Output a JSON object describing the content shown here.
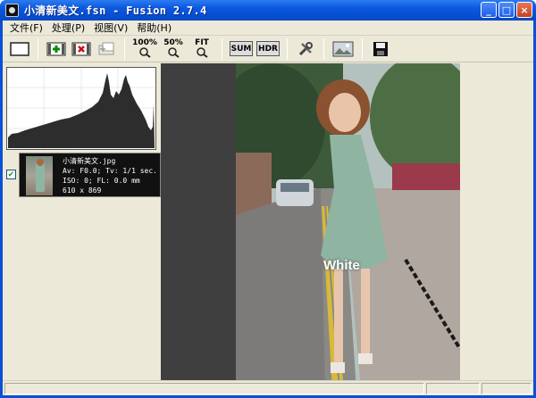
{
  "window": {
    "title": "小清新美文.fsn - Fusion 2.7.4"
  },
  "titlebar_buttons": {
    "minimize": "_",
    "maximize": "□",
    "close": "×"
  },
  "menu": [
    {
      "label": "文件(F)"
    },
    {
      "label": "处理(P)"
    },
    {
      "label": "视图(V)"
    },
    {
      "label": "帮助(H)"
    }
  ],
  "toolbar": {
    "zoom_100": "100%",
    "zoom_50": "50%",
    "zoom_fit": "FIT",
    "sum": "SUM",
    "hdr": "HDR"
  },
  "thumbnail": {
    "checked": true,
    "filename": "小清新美文.jpg",
    "line2": "Av: F0.0; Tv: 1/1 sec.",
    "line3": "ISO: 0; FL: 0.0 mm",
    "line4": "610 x 869"
  },
  "photo": {
    "watermark": "White"
  },
  "icons": [
    "app-icon",
    "new-icon",
    "add-icon",
    "remove-icon",
    "move-icon",
    "zoom-100-icon",
    "zoom-50-icon",
    "zoom-fit-icon",
    "sum-icon",
    "hdr-icon",
    "settings-icon",
    "export-image-icon",
    "save-icon",
    "check-icon"
  ]
}
